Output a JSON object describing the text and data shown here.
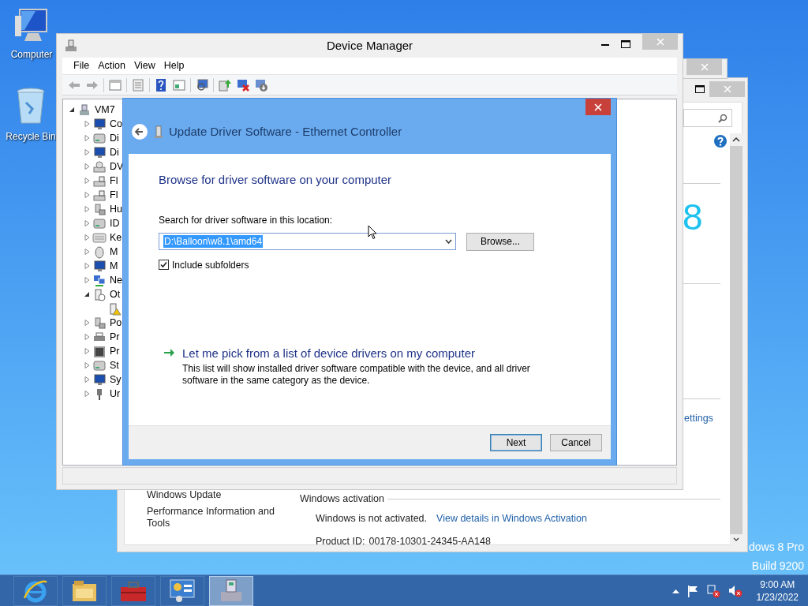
{
  "desktop_icons": [
    {
      "label": "Computer",
      "kind": "computer"
    },
    {
      "label": "Recycle Bin",
      "kind": "recycle"
    }
  ],
  "system_window": {
    "big_text": "8",
    "link": "ettings",
    "sidebar_links": [
      "Windows Update",
      "Performance Information and Tools"
    ],
    "section_title": "Windows activation",
    "activation_status": "Windows is not activated.",
    "activation_link": "View details in Windows Activation",
    "product_id_label": "Product ID:",
    "product_id": "00178-10301-24345-AA148"
  },
  "device_manager": {
    "title": "Device Manager",
    "menu": [
      "File",
      "Action",
      "View",
      "Help"
    ],
    "tree": {
      "label": "VM7",
      "kind": "host",
      "expanded": true,
      "children": [
        {
          "label": "Co",
          "kind": "computer",
          "expanded": false
        },
        {
          "label": "Di",
          "kind": "disk",
          "expanded": false
        },
        {
          "label": "Di",
          "kind": "display",
          "expanded": false
        },
        {
          "label": "DV",
          "kind": "dvd",
          "expanded": false
        },
        {
          "label": "Fl",
          "kind": "floppy",
          "expanded": false
        },
        {
          "label": "Fl",
          "kind": "floppy",
          "expanded": false
        },
        {
          "label": "Hu",
          "kind": "hid",
          "expanded": false
        },
        {
          "label": "ID",
          "kind": "ide",
          "expanded": false
        },
        {
          "label": "Ke",
          "kind": "keyboard",
          "expanded": false
        },
        {
          "label": "M",
          "kind": "mouse",
          "expanded": false
        },
        {
          "label": "M",
          "kind": "monitor",
          "expanded": false
        },
        {
          "label": "Ne",
          "kind": "network",
          "expanded": false
        },
        {
          "label": "Ot",
          "kind": "other",
          "expanded": true,
          "children": [
            {
              "kind": "warning"
            }
          ]
        },
        {
          "label": "Po",
          "kind": "ports",
          "expanded": false
        },
        {
          "label": "Pr",
          "kind": "printer",
          "expanded": false
        },
        {
          "label": "Pr",
          "kind": "processor",
          "expanded": false
        },
        {
          "label": "St",
          "kind": "storage",
          "expanded": false
        },
        {
          "label": "Sy",
          "kind": "computer",
          "expanded": false
        },
        {
          "label": "Ur",
          "kind": "usb",
          "expanded": false
        }
      ]
    }
  },
  "dialog": {
    "title": "Update Driver Software - Ethernet Controller",
    "heading": "Browse for driver software on your computer",
    "location_label": "Search for driver software in this location:",
    "location_value": "D:\\Balloon\\w8.1\\amd64",
    "browse": "Browse...",
    "include_subfolders": {
      "label": "Include subfolders",
      "checked": true
    },
    "pick_link": "Let me pick from a list of device drivers on my computer",
    "pick_description": "This list will show installed driver software compatible with the device, and all driver software in the same category as the device.",
    "buttons": [
      {
        "label": "Next",
        "default": true
      },
      {
        "label": "Cancel",
        "default": false
      }
    ]
  },
  "desktop_version": [
    "dows 8 Pro",
    "Build 9200"
  ],
  "taskbar": {
    "apps": [
      {
        "kind": "ie",
        "selected": false
      },
      {
        "kind": "explorer",
        "selected": false
      },
      {
        "kind": "toolbox",
        "selected": false
      },
      {
        "kind": "control-panel",
        "selected": false
      },
      {
        "kind": "device-manager",
        "selected": true
      }
    ],
    "clock": {
      "time": "9:00 AM",
      "date": "1/23/2022"
    }
  }
}
